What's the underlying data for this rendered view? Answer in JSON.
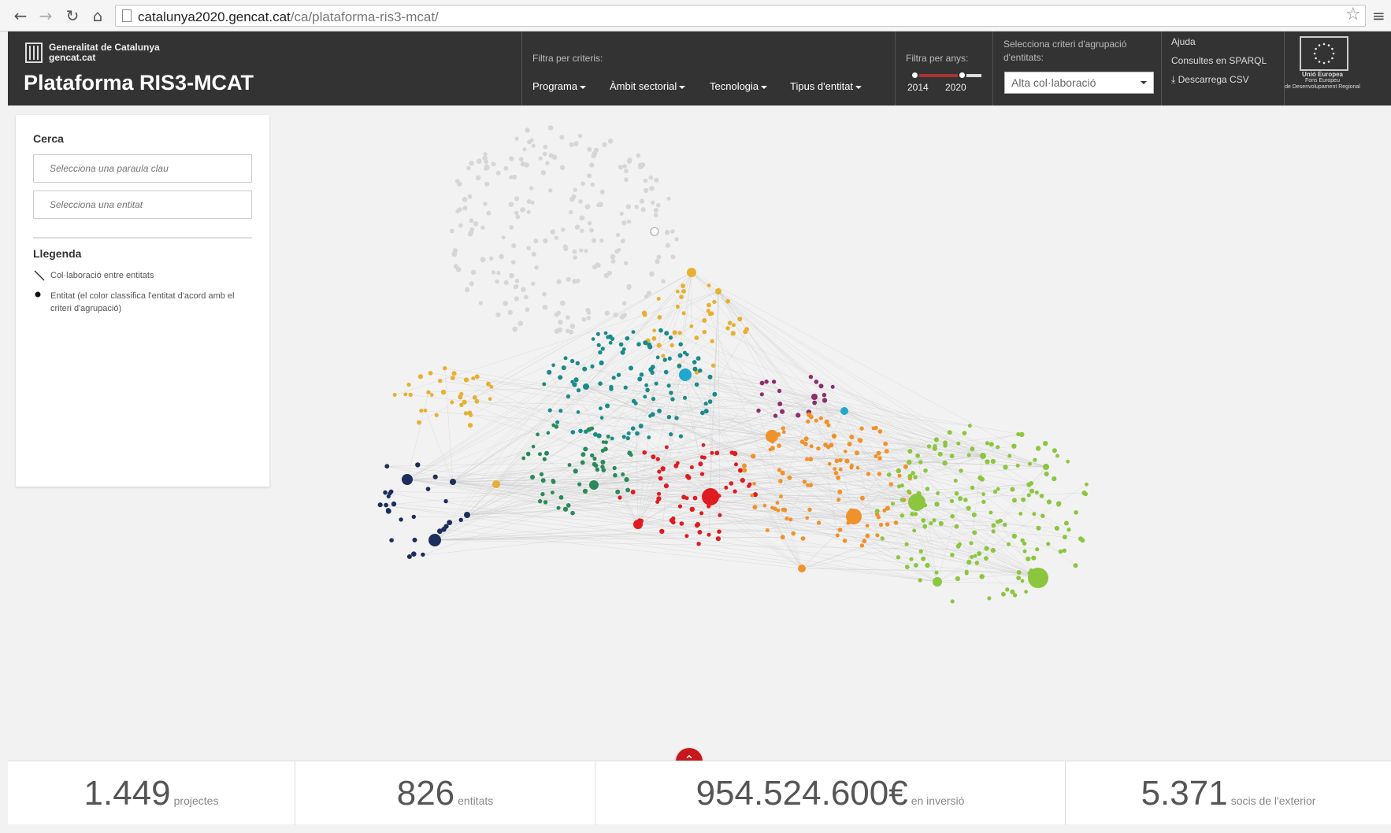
{
  "browser": {
    "back_icon": "←",
    "forward_icon": "→",
    "reload_icon": "↻",
    "home_icon": "⌂",
    "url_domain": "catalunya2020.gencat.cat",
    "url_path": "/ca/plataforma-ris3-mcat/",
    "star_icon": "☆",
    "menu_icon": "≡"
  },
  "header": {
    "org_name": "Generalitat de Catalunya",
    "org_site": "gencat.cat",
    "title": "Plataforma RIS3-MCAT",
    "filter_label": "Filtra per criteris:",
    "filters": [
      "Programa",
      "Àmbit sectorial",
      "Tecnologia",
      "Tipus d'entitat"
    ],
    "years_label": "Filtra per anys:",
    "year_start": "2014",
    "year_end": "2020",
    "group_label_1": "Selecciona criteri d'agrupació",
    "group_label_2": "d'entitats:",
    "group_selected": "Alta col·laboració",
    "help_link": "Ajuda",
    "sparql_link": "Consultes en SPARQL",
    "csv_link": "⤓ Descarrega CSV",
    "eu_line1": "Unió Europea",
    "eu_line2": "Fons Europeu",
    "eu_line3": "de Desenvolupament Regional"
  },
  "sidebar": {
    "search_title": "Cerca",
    "keyword_placeholder": "Selecciona una paraula clau",
    "entity_placeholder": "Selecciona una entitat",
    "legend_title": "Llegenda",
    "legend_line": "Col·laboració entre entitats",
    "legend_node": "Entitat (el color classifica l'entitat d'acord amb el criteri d'agrupació)"
  },
  "graph": {
    "clusters": [
      {
        "name": "grey",
        "color": "#d6d6d6"
      },
      {
        "name": "navy",
        "color": "#1c2f5c"
      },
      {
        "name": "teal",
        "color": "#1a8a8a"
      },
      {
        "name": "green-dark",
        "color": "#2a8a5a"
      },
      {
        "name": "red",
        "color": "#e01b22"
      },
      {
        "name": "orange",
        "color": "#f0922b"
      },
      {
        "name": "gold",
        "color": "#e8b030"
      },
      {
        "name": "lime",
        "color": "#8cc63f"
      },
      {
        "name": "purple",
        "color": "#8b2f6a"
      },
      {
        "name": "cyan",
        "color": "#20a8d0"
      }
    ]
  },
  "scroll_top_icon": "⌃",
  "stats": [
    {
      "value": "1.449",
      "unit": "projectes"
    },
    {
      "value": "826",
      "unit": "entitats"
    },
    {
      "value": "954.524.600€",
      "unit": "en inversió"
    },
    {
      "value": "5.371",
      "unit": "socis de l'exterior"
    }
  ]
}
